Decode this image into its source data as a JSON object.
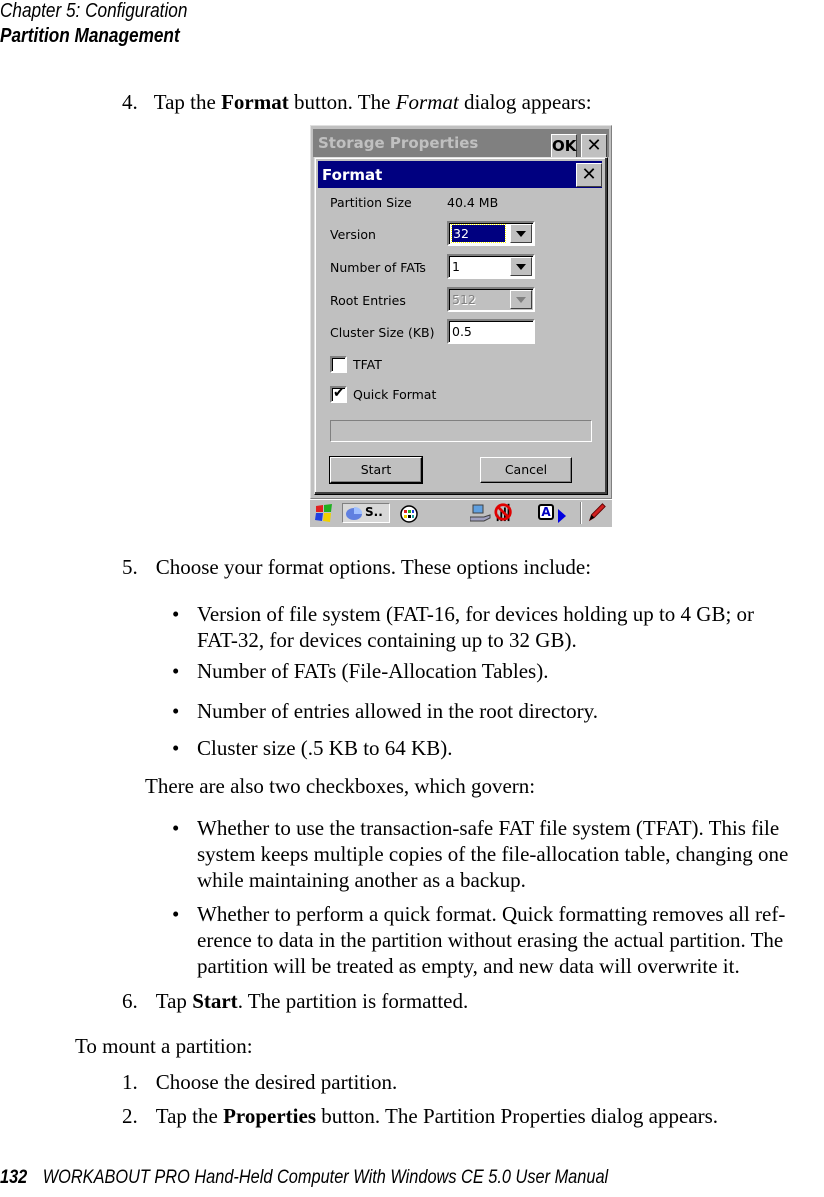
{
  "header": {
    "chapter": "Chapter  5:  Configuration",
    "section": "Partition Management"
  },
  "steps_a": [
    {
      "num": "4.",
      "pre": "Tap the ",
      "bold": "Format",
      "mid": " button. The ",
      "italic": "Format",
      "post": " dialog appears:"
    }
  ],
  "screenshot": {
    "outer_title": "Storage Properties",
    "ok_label": "OK",
    "close_glyph": "✕",
    "dialog_title": "Format",
    "fields": {
      "partition_size_label": "Partition Size",
      "partition_size_value": "40.4 MB",
      "version_label": "Version",
      "version_value": "32",
      "fats_label": "Number of FATs",
      "fats_value": "1",
      "root_entries_label": "Root Entries",
      "root_entries_value": "512",
      "cluster_label": "Cluster Size (KB)",
      "cluster_value": "0.5"
    },
    "checkboxes": {
      "tfat_label": "TFAT",
      "tfat_checked": false,
      "quick_label": "Quick Format",
      "quick_checked": true,
      "check_glyph": "✔"
    },
    "progress": 0,
    "start_label": "Start",
    "cancel_label": "Cancel",
    "taskbar": {
      "start_icon": "windows-flag-icon",
      "task_label": "S..",
      "input_label": "A",
      "colors": {
        "flag_red": "#e02020",
        "flag_green": "#20b020",
        "flag_blue": "#2040e0",
        "flag_yellow": "#f0d000",
        "title_blue": "#000080",
        "gray": "#c0c0c0"
      }
    }
  },
  "step5": {
    "num": "5.",
    "text": "Choose your format options. These options include:",
    "bullets": [
      [
        "Version of file system (FAT-16, for devices holding up to 4 GB; or",
        "FAT-32, for devices containing up to 32 GB)."
      ],
      [
        "Number of FATs (File-Allocation Tables)."
      ],
      [
        "Number of entries allowed in the root directory."
      ],
      [
        "Cluster size (.5 KB to 64 KB)."
      ]
    ],
    "checkbox_intro": "There are also two checkboxes, which govern:",
    "checkbox_bullets": [
      [
        "Whether to use the transaction-safe FAT file system (TFAT). This file",
        "system keeps multiple copies of the file-allocation table, changing one",
        "while maintaining another as a backup."
      ],
      [
        "Whether to perform a quick format. Quick formatting removes all ref-",
        "erence to data in the partition without erasing the actual partition. The",
        "partition will be treated as empty, and new data will overwrite it."
      ]
    ],
    "bullet_glyph": "•"
  },
  "step6": {
    "num": "6.",
    "pre": "Tap ",
    "bold": "Start",
    "post": ". The partition is formatted."
  },
  "mount": {
    "intro": "To mount a partition:",
    "steps": [
      {
        "num": "1.",
        "pre": "Choose the desired partition.",
        "bold": "",
        "post": ""
      },
      {
        "num": "2.",
        "pre": "Tap the ",
        "bold": "Properties",
        "post": " button. The Partition Properties dialog appears."
      }
    ]
  },
  "footer": {
    "page": "132",
    "title": "WORKABOUT PRO Hand-Held Computer With Windows CE 5.0 User Manual"
  }
}
